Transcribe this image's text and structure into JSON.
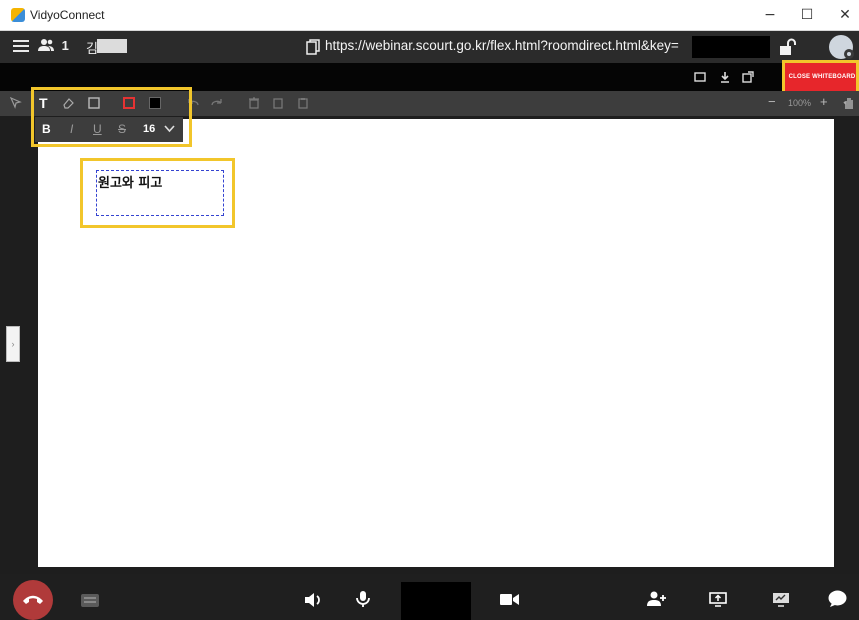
{
  "window": {
    "title": "VidyoConnect",
    "controls": {
      "minimize": "−",
      "maximize": "☐",
      "close": "✕"
    }
  },
  "header": {
    "participant_count": "1",
    "user_name": "김",
    "url": "https://webinar.scourt.go.kr/flex.html?roomdirect.html&key="
  },
  "whiteboard": {
    "close_label": "CLOSE WHITEBOARD",
    "zoom": "100%",
    "font_size": "16",
    "format": {
      "bold": "B",
      "italic": "I",
      "underline": "U",
      "strike": "S"
    },
    "textbox_text": "원고와 피고"
  },
  "colors": {
    "accent_red": "#e7262b",
    "highlight": "#f2c62b",
    "hangup": "#b03a3a",
    "selection_border": "#3443d0"
  },
  "icons": {
    "toolbar": [
      "select-icon",
      "text-icon",
      "eraser-icon",
      "rectangle-icon",
      "border-color-icon",
      "fill-color-icon",
      "undo-icon",
      "redo-icon",
      "delete-icon",
      "copy-icon",
      "paste-icon",
      "zoom-out-icon",
      "zoom-in-icon",
      "hand-pan-icon"
    ],
    "bottom": [
      "hangup-icon",
      "keypad-icon",
      "speaker-icon",
      "microphone-icon",
      "camera-icon",
      "add-participant-icon",
      "share-screen-icon",
      "whiteboard-icon",
      "chat-icon"
    ]
  }
}
